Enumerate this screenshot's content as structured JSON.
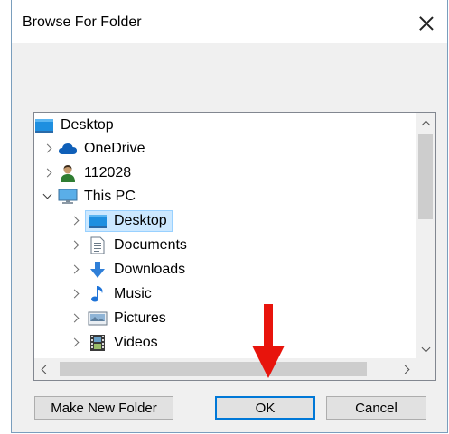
{
  "dialog": {
    "title": "Browse For Folder"
  },
  "tree": {
    "items": [
      {
        "label": "Desktop",
        "icon": "desktop-icon",
        "expander": "none",
        "level": 0
      },
      {
        "label": "OneDrive",
        "icon": "onedrive-cloud-icon",
        "expander": "collapsed",
        "level": 1
      },
      {
        "label": "112028",
        "icon": "user-icon",
        "expander": "collapsed",
        "level": 1
      },
      {
        "label": "This PC",
        "icon": "this-pc-icon",
        "expander": "expanded",
        "level": 1
      },
      {
        "label": "Desktop",
        "icon": "desktop-icon",
        "expander": "collapsed",
        "level": 2,
        "selected": true
      },
      {
        "label": "Documents",
        "icon": "documents-icon",
        "expander": "collapsed",
        "level": 2
      },
      {
        "label": "Downloads",
        "icon": "downloads-icon",
        "expander": "collapsed",
        "level": 2
      },
      {
        "label": "Music",
        "icon": "music-icon",
        "expander": "collapsed",
        "level": 2
      },
      {
        "label": "Pictures",
        "icon": "pictures-icon",
        "expander": "collapsed",
        "level": 2
      },
      {
        "label": "Videos",
        "icon": "videos-icon",
        "expander": "collapsed",
        "level": 2
      }
    ]
  },
  "buttons": {
    "make_new_folder": "Make New Folder",
    "ok": "OK",
    "cancel": "Cancel"
  },
  "colors": {
    "selection_bg": "#cce8ff",
    "selection_border": "#99d1ff",
    "default_button_border": "#0078d7",
    "annotation_arrow": "#e8140c"
  }
}
